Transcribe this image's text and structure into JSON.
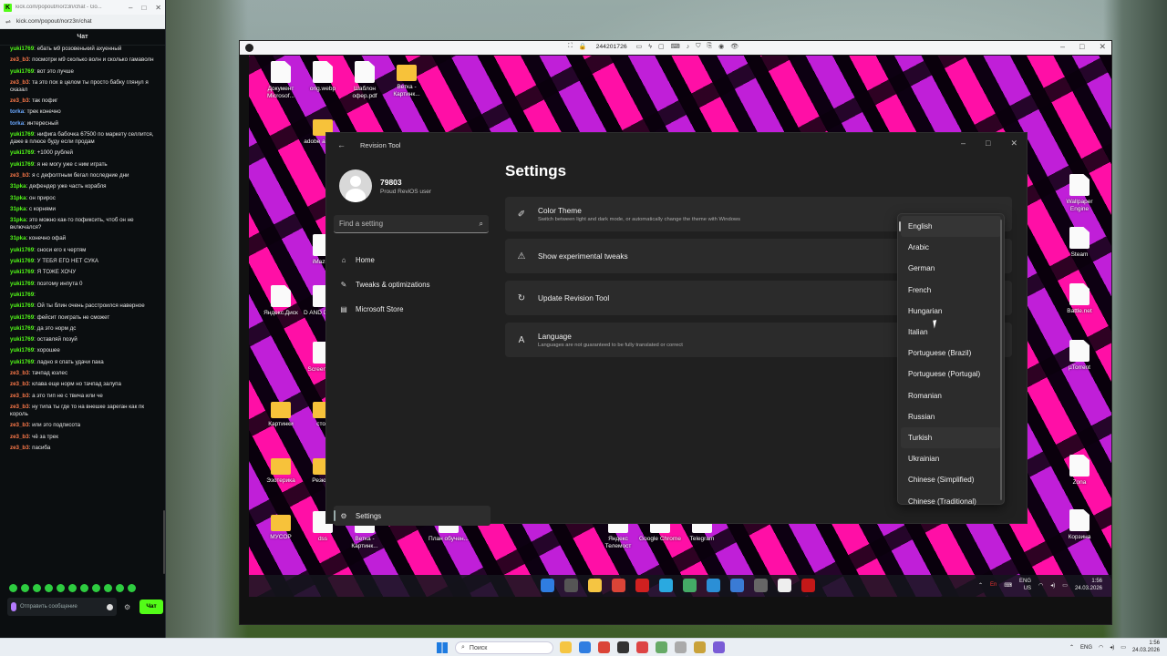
{
  "chat": {
    "window_title": "kick.com/popout/norz3n/chat - Go...",
    "url": "kick.com/popout/norz3n/chat",
    "header": "Чат",
    "messages": [
      {
        "user": "yuki1769",
        "color": "#53fc18",
        "text": "ебать м9 розовенький ахуенный"
      },
      {
        "user": "ze3_b3",
        "color": "#ff7a4a",
        "text": "посмотри м9 сколько волн и сколько гамаволн"
      },
      {
        "user": "yuki1769",
        "color": "#53fc18",
        "text": "вот это лучше"
      },
      {
        "user": "ze3_b3",
        "color": "#ff7a4a",
        "text": "та это пох в целом ты просто бабку глянул я сказал"
      },
      {
        "user": "ze3_b3",
        "color": "#ff7a4a",
        "text": "так пофиг"
      },
      {
        "user": "torka",
        "color": "#6aa8ff",
        "text": "трек конечно"
      },
      {
        "user": "torka",
        "color": "#6aa8ff",
        "text": "интересный"
      },
      {
        "user": "yuki1769",
        "color": "#53fc18",
        "text": "нифига бабочка 67500 по маркету селлится, даже в плюсе буду если продам"
      },
      {
        "user": "yuki1769",
        "color": "#53fc18",
        "text": "+1000 рублей"
      },
      {
        "user": "yuki1769",
        "color": "#53fc18",
        "text": "я не могу уже с ним играть"
      },
      {
        "user": "ze3_b3",
        "color": "#ff7a4a",
        "text": "я с дефолтным бегал последние дни"
      },
      {
        "user": "31pka",
        "color": "#53fc18",
        "text": "дефендер уже часть корабля"
      },
      {
        "user": "31pka",
        "color": "#53fc18",
        "text": "он прирос"
      },
      {
        "user": "31pka",
        "color": "#53fc18",
        "text": "с корнями"
      },
      {
        "user": "31pka",
        "color": "#53fc18",
        "text": "это можно как-то пофиксить, чтоб он не включался?"
      },
      {
        "user": "31pka",
        "color": "#53fc18",
        "text": "конечно офай"
      },
      {
        "user": "yuki1769",
        "color": "#53fc18",
        "text": "сноси его к чертям"
      },
      {
        "user": "yuki1769",
        "color": "#53fc18",
        "text": "У ТЕБЯ ЕГО НЕТ СУКА"
      },
      {
        "user": "yuki1769",
        "color": "#53fc18",
        "text": "Я ТОЖЕ ХОЧУ"
      },
      {
        "user": "yuki1769",
        "color": "#53fc18",
        "text": "поэтому инпута 0"
      },
      {
        "user": "yuki1769",
        "color": "#53fc18",
        "text": ""
      },
      {
        "user": "yuki1769",
        "color": "#53fc18",
        "text": "Ой ты блин очень расстроился наверное"
      },
      {
        "user": "yuki1769",
        "color": "#53fc18",
        "text": "фейсит поиграть не сможет"
      },
      {
        "user": "yuki1769",
        "color": "#53fc18",
        "text": "да это норм дс"
      },
      {
        "user": "yuki1769",
        "color": "#53fc18",
        "text": "оставляй позуй"
      },
      {
        "user": "yuki1769",
        "color": "#53fc18",
        "text": "хорошее"
      },
      {
        "user": "yuki1769",
        "color": "#53fc18",
        "text": "ладно я спать удачи пака"
      },
      {
        "user": "ze3_b3",
        "color": "#ff7a4a",
        "text": "тачпад юзлес"
      },
      {
        "user": "ze3_b3",
        "color": "#ff7a4a",
        "text": "клава еще норм но тачпад залупа"
      },
      {
        "user": "ze3_b3",
        "color": "#ff7a4a",
        "text": "а это тип не с твича или че"
      },
      {
        "user": "ze3_b3",
        "color": "#ff7a4a",
        "text": "ну типа ты где то на внешке зареган как пк король"
      },
      {
        "user": "ze3_b3",
        "color": "#ff7a4a",
        "text": "или это подписота"
      },
      {
        "user": "ze3_b3",
        "color": "#ff7a4a",
        "text": "чё за трек"
      },
      {
        "user": "ze3_b3",
        "color": "#ff7a4a",
        "text": "пасиба"
      }
    ],
    "input_placeholder": "Отправить сообщение",
    "send_label": "Чат"
  },
  "viewer": {
    "session_id": "244201726"
  },
  "desktop_icons": [
    {
      "label": "Документ Microsof...",
      "kind": "file"
    },
    {
      "label": "orig.webp",
      "kind": "file"
    },
    {
      "label": "Шаблон офер.pdf",
      "kind": "file"
    },
    {
      "label": "Ветка - Картинк...",
      "kind": "folder"
    },
    {
      "label": "adobe acrobat",
      "kind": "folder"
    },
    {
      "label": "iMazing",
      "kind": "file"
    },
    {
      "label": "Яндекс.Диск",
      "kind": "file"
    },
    {
      "label": "D AND D.docx",
      "kind": "file"
    },
    {
      "label": "Screenshot",
      "kind": "file"
    },
    {
      "label": "Картинки",
      "kind": "folder"
    },
    {
      "label": "стол",
      "kind": "folder"
    },
    {
      "label": "Эзотерика",
      "kind": "folder"
    },
    {
      "label": "Резюме",
      "kind": "folder"
    },
    {
      "label": "МУСОР",
      "kind": "folder"
    },
    {
      "label": "dss",
      "kind": "file"
    },
    {
      "label": "Ветка - Картинк...",
      "kind": "file"
    },
    {
      "label": "План обучен...",
      "kind": "file"
    },
    {
      "label": "Яндекс Телемост",
      "kind": "file"
    },
    {
      "label": "Google Chrome",
      "kind": "file"
    },
    {
      "label": "Telegram",
      "kind": "file"
    },
    {
      "label": "Wallpaper Engine",
      "kind": "file"
    },
    {
      "label": "Steam",
      "kind": "file"
    },
    {
      "label": "Battle.net",
      "kind": "file"
    },
    {
      "label": "µTorrent",
      "kind": "file"
    },
    {
      "label": "Zona",
      "kind": "file"
    },
    {
      "label": "Корзина",
      "kind": "file"
    },
    {
      "label": "Новая папка (2)",
      "kind": "folder"
    },
    {
      "label": "Новая папка",
      "kind": "folder"
    }
  ],
  "app": {
    "title": "Revision Tool",
    "profile_name": "79803",
    "profile_sub": "Proud ReviOS user",
    "search_placeholder": "Find a setting",
    "nav": [
      {
        "label": "Home",
        "icon": "home-icon"
      },
      {
        "label": "Tweaks & optimizations",
        "icon": "wrench-icon"
      },
      {
        "label": "Microsoft Store",
        "icon": "store-icon"
      }
    ],
    "nav_settings": "Settings",
    "page_title": "Settings",
    "cards": [
      {
        "title": "Color Theme",
        "subtitle": "Switch between light and dark mode, or automatically change the theme with Windows",
        "icon": "brush-icon"
      },
      {
        "title": "Show experimental tweaks",
        "subtitle": "",
        "icon": "warning-icon"
      },
      {
        "title": "Update Revision Tool",
        "subtitle": "",
        "icon": "refresh-icon"
      },
      {
        "title": "Language",
        "subtitle": "Languages are not guaranteed to be fully translated or correct",
        "icon": "language-icon"
      }
    ],
    "languages": [
      "English",
      "Arabic",
      "German",
      "French",
      "Hungarian",
      "Italian",
      "Portuguese (Brazil)",
      "Portuguese (Portugal)",
      "Romanian",
      "Russian",
      "Turkish",
      "Ukrainian",
      "Chinese (Simplified)",
      "Chinese (Traditional)"
    ],
    "selected_language": "English"
  },
  "remote_taskbar": {
    "lang": "ENG",
    "region": "US",
    "time": "1:56",
    "date": "24.03.2026",
    "tray_en": "En"
  },
  "host_taskbar": {
    "search_placeholder": "Поиск",
    "lang": "ENG",
    "time": "1:56",
    "date": "24.03.2026"
  }
}
